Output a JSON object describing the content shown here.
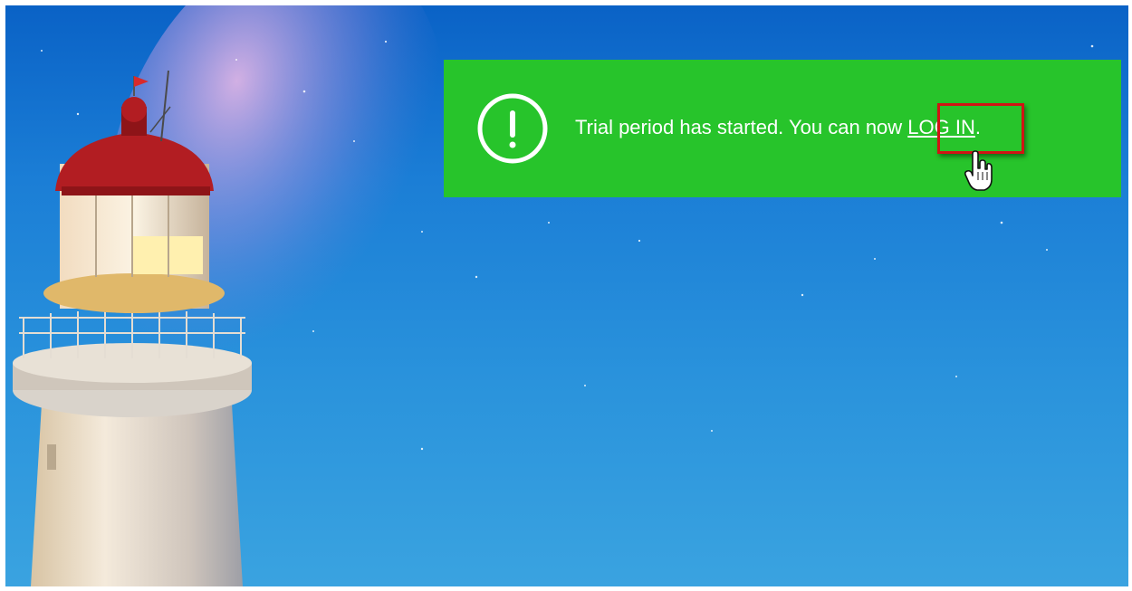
{
  "notification": {
    "icon": "exclamation-circle-icon",
    "message_prefix": "Trial period has started. You can now ",
    "login_link": "LOG IN",
    "message_suffix": ".",
    "background_color": "#27c42b"
  },
  "annotation": {
    "highlight_color": "#d11414",
    "cursor": "hand-pointer-icon"
  }
}
